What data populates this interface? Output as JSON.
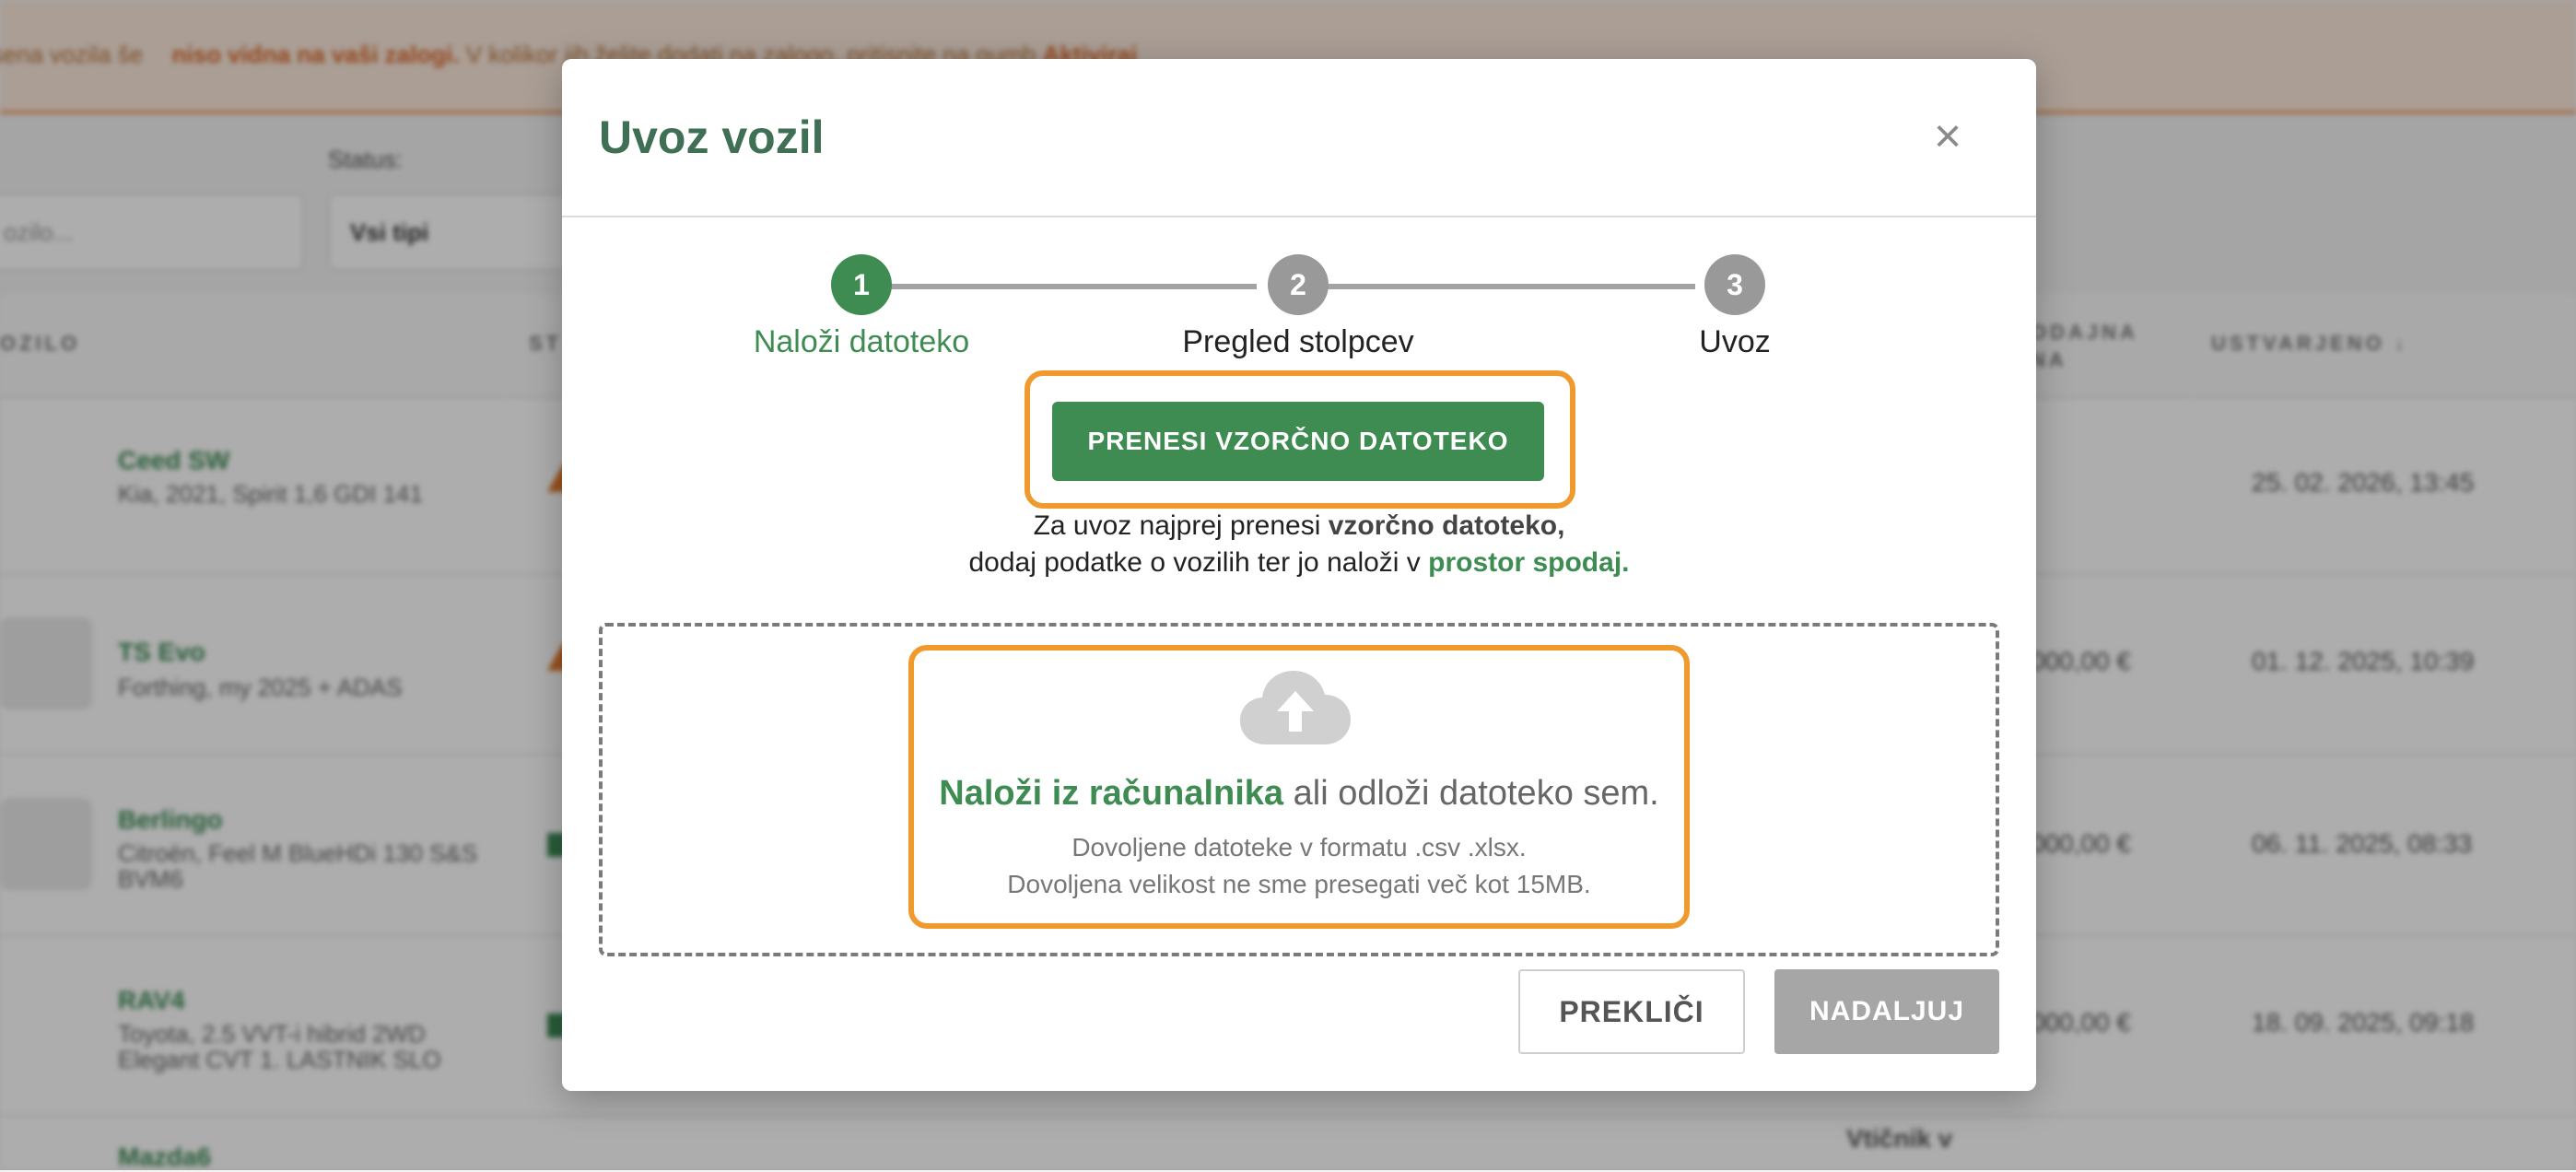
{
  "background": {
    "banner": {
      "prefix": "esena vozila še ",
      "bold1": "niso vidna na vaši zalogi.",
      "middle": " V kolikor jih želite dodati na zalogo, pritisnite na gumb ",
      "bold2": "Aktiviraj"
    },
    "filters": {
      "search_placeholder": "ozilo...",
      "status_label": "Status:",
      "status_value": "Vsi tipi"
    },
    "columns": {
      "vehicle": "OZILO",
      "status": "ST",
      "price": "ODAJNA\nNA",
      "created": "USTVARJENO ↓"
    },
    "rows": [
      {
        "name": "Ceed SW",
        "desc": "Kia, 2021, Spirit 1,6 GDI 141",
        "price": "",
        "created": "25. 02. 2026, 13:45"
      },
      {
        "name": "TS Evo",
        "desc": "Forthing, my 2025 + ADAS",
        "price": "000,00 €",
        "created": "01. 12. 2025, 10:39"
      },
      {
        "name": "Berlingo",
        "desc": "Citroën, Feel M BlueHDi 130 S&S BVM6",
        "price": "000,00 €",
        "created": "06. 11. 2025, 08:33"
      },
      {
        "name": "RAV4",
        "desc": "Toyota, 2.5 VVT-i hibrid 2WD Elegant CVT 1. LASTNIK SLO",
        "price": "000,00 €",
        "created": "18. 09. 2025, 09:18"
      },
      {
        "name": "Mazda6",
        "desc": "",
        "price": "",
        "created": "",
        "extra": "Vtičnik v"
      }
    ]
  },
  "modal": {
    "title": "Uvoz vozil",
    "close_label": "×",
    "steps": [
      {
        "number": "1",
        "label": "Naloži datoteko",
        "state": "active"
      },
      {
        "number": "2",
        "label": "Pregled stolpcev",
        "state": "inactive"
      },
      {
        "number": "3",
        "label": "Uvoz",
        "state": "inactive"
      }
    ],
    "sample_button_label": "PRENESI VZORČNO DATOTEKO",
    "instructions": {
      "line1_prefix": "Za uvoz najprej prenesi ",
      "line1_bold": "vzorčno datoteko,",
      "line2_prefix": "dodaj podatke o vozilih ter jo naloži v ",
      "line2_bold": "prostor spodaj."
    },
    "dropzone": {
      "upload_link": "Naloži iz računalnika",
      "upload_rest": " ali odloži datoteko sem.",
      "formats_hint": "Dovoljene datoteke v formatu .csv .xlsx.",
      "size_hint": "Dovoljena velikost ne sme presegati več kot 15MB."
    },
    "cancel_label": "PREKLIČI",
    "continue_label": "NADALJUJ"
  },
  "colors": {
    "primary_green": "#3e8c52",
    "title_green": "#3f6f54",
    "highlight_orange": "#f09a2e",
    "disabled_gray": "#a6a6a6",
    "step_inactive": "#999999"
  },
  "icons": {
    "close": "close-icon",
    "upload": "cloud-upload-icon"
  }
}
